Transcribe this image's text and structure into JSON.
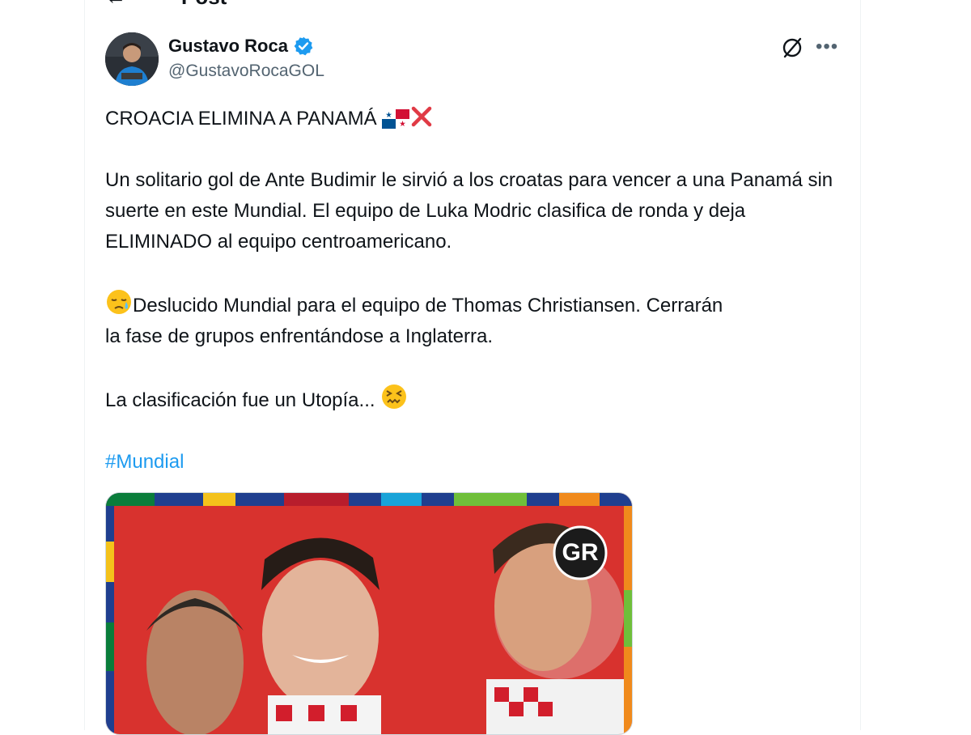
{
  "header": {
    "title": "Post"
  },
  "author": {
    "name": "Gustavo Roca",
    "handle": "@GustavoRocaGOL"
  },
  "post": {
    "line1": "CROACIA ELIMINA A PANAMÁ",
    "para2": "Un solitario gol de Ante Budimir le sirvió a los croatas para vencer a una Panamá sin suerte en este Mundial. El equipo de Luka Modric clasifica de ronda y deja ELIMINADO al equipo centroamericano.",
    "para3_line1": "Deslucido Mundial para el equipo de Thomas Christiansen. Cerrarán",
    "para3_line2": "la fase de grupos enfrentándose a Inglaterra.",
    "para4": "La clasificación fue un Utopía...",
    "hashtag": "#Mundial"
  },
  "media": {
    "watermark": "GR"
  },
  "colors": {
    "accent": "#1d9bf0",
    "verified": "#1d9bf0",
    "secondary_text": "#536471"
  },
  "icons": [
    "back-arrow-icon",
    "verified-badge-icon",
    "grok-icon",
    "more-icon",
    "panama-flag-icon",
    "cross-mark-icon",
    "sad-face-icon",
    "confounded-face-icon"
  ]
}
